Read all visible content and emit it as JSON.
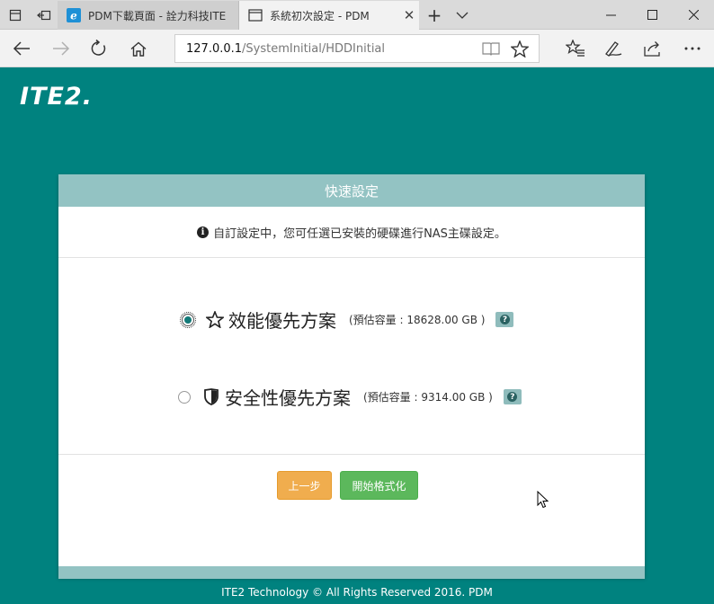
{
  "browser": {
    "tabs": [
      {
        "title": "PDM下載頁面 - 詮力科技ITE",
        "active": false
      },
      {
        "title": "系統初次設定 - PDM",
        "active": true
      }
    ],
    "address": {
      "host": "127.0.0.1",
      "path": "/SystemInitial/HDDInitial"
    }
  },
  "page": {
    "logo_text": "ITE2",
    "logo_dot": ".",
    "card_title": "快速設定",
    "notice": "自訂設定中，您可任選已安裝的硬碟進行NAS主碟設定。",
    "options": [
      {
        "label": "效能優先方案",
        "estimate": "(預估容量 : 18628.00 GB )",
        "icon": "star-outline-icon",
        "selected": true
      },
      {
        "label": "安全性優先方案",
        "estimate": "(預估容量 : 9314.00 GB )",
        "icon": "shield-icon",
        "selected": false
      }
    ],
    "buttons": {
      "prev": "上一步",
      "start": "開始格式化"
    },
    "footer": "ITE2 Technology © All Rights Reserved 2016. PDM"
  },
  "colors": {
    "page_bg": "#00827f",
    "card_header": "#93c3c3",
    "prev_button": "#f0ad4e",
    "start_button": "#5cb85c",
    "help_badge": "#8fbcbc"
  }
}
